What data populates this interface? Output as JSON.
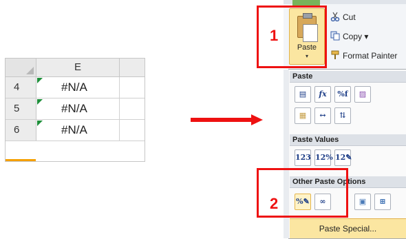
{
  "spreadsheet": {
    "column_header": "E",
    "rows": [
      {
        "number": "4",
        "value": "#N/A"
      },
      {
        "number": "5",
        "value": "#N/A"
      },
      {
        "number": "6",
        "value": "#N/A"
      }
    ]
  },
  "ribbon": {
    "paste_label": "Paste",
    "paste_dropdown": "▾",
    "cut_label": "Cut",
    "copy_label": "Copy ▾",
    "format_painter_label": "Format Painter"
  },
  "paste_menu": {
    "section_paste": "Paste",
    "section_paste_values": "Paste Values",
    "section_other": "Other Paste Options",
    "paste_icons": [
      "paste-icon",
      "formulas-icon",
      "formulas-number-format-icon",
      "keep-source-formatting-icon",
      "no-borders-icon",
      "keep-column-widths-icon",
      "transpose-icon"
    ],
    "value_icons": [
      "values-icon",
      "values-number-format-icon",
      "values-source-formatting-icon"
    ],
    "other_icons": [
      "formatting-icon",
      "paste-link-icon",
      "picture-icon",
      "linked-picture-icon"
    ],
    "paste_special_label": "Paste Special..."
  },
  "callouts": {
    "one": "1",
    "two": "2"
  },
  "colors": {
    "callout_red": "#ee1111",
    "highlight_gold": "#fbe6a1",
    "error_triangle_green": "#1e8f3a"
  }
}
